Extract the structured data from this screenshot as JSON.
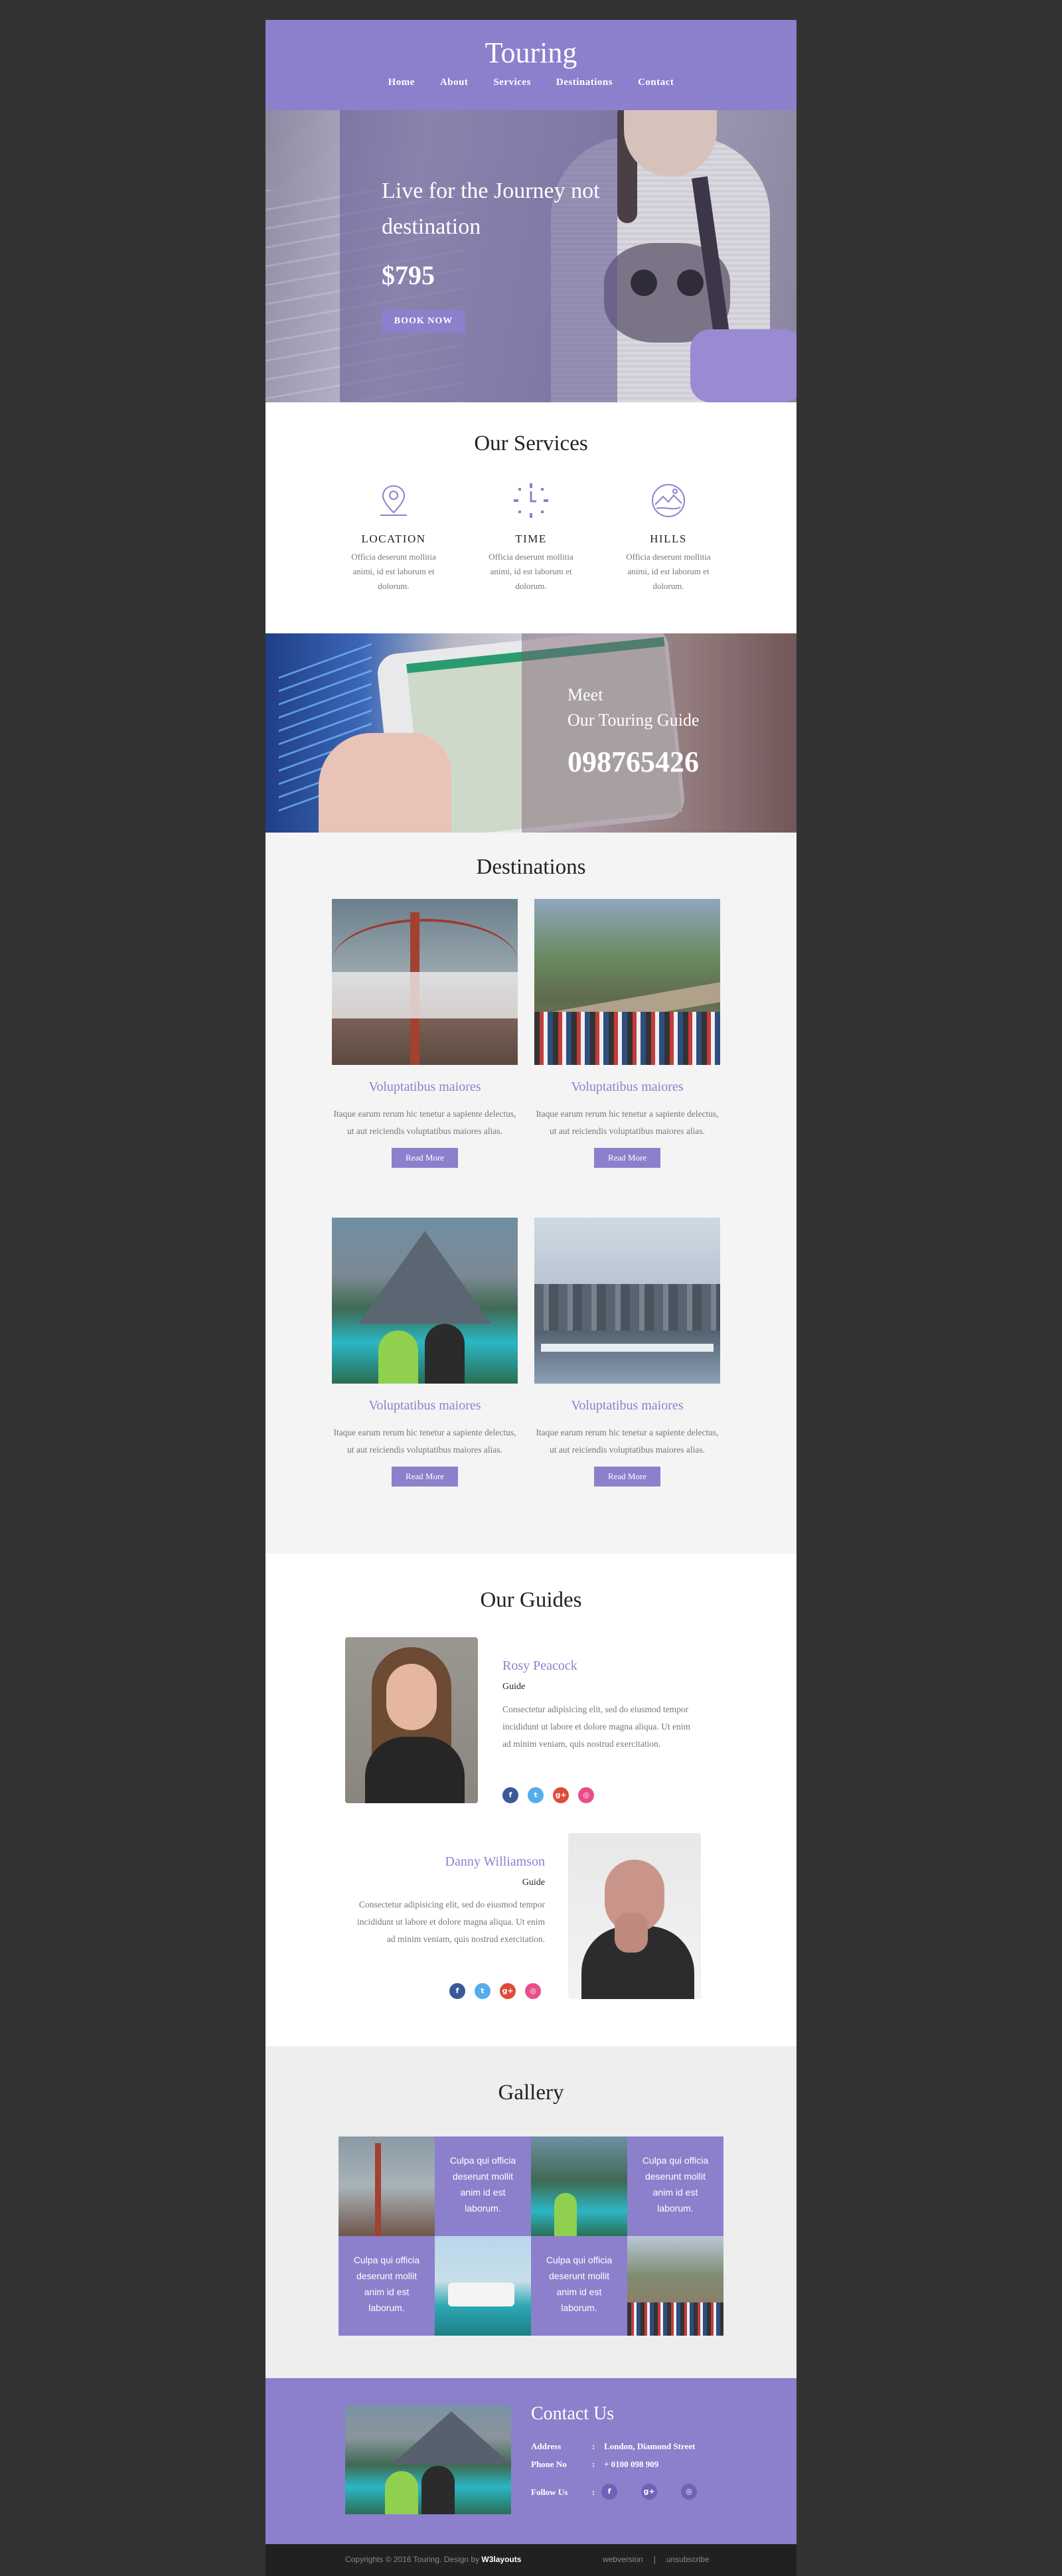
{
  "header": {
    "logo": "Touring",
    "nav": [
      "Home",
      "About",
      "Services",
      "Destinations",
      "Contact"
    ]
  },
  "hero": {
    "title": "Live for the Journey not destination",
    "price": "$795",
    "button": "BOOK NOW"
  },
  "services": {
    "title": "Our Services",
    "items": [
      {
        "icon": "map-pin-icon",
        "title": "LOCATION",
        "text": "Officia deserunt mollitia animi, id est laborum et dolorum."
      },
      {
        "icon": "clock-icon",
        "title": "TIME",
        "text": "Officia deserunt mollitia animi, id est laborum et dolorum."
      },
      {
        "icon": "hills-icon",
        "title": "HILLS",
        "text": "Officia deserunt mollitia animi, id est laborum et dolorum."
      }
    ]
  },
  "guide_banner": {
    "title_line1": "Meet",
    "title_line2": "Our Touring Guide",
    "phone": "098765426"
  },
  "destinations": {
    "title": "Destinations",
    "cards": [
      {
        "title": "Voluptatibus maiores",
        "text": "Itaque earum rerum hic tenetur a sapiente delectus, ut aut reiciendis voluptatibus maiores alias.",
        "button": "Read More"
      },
      {
        "title": "Voluptatibus maiores",
        "text": "Itaque earum rerum hic tenetur a sapiente delectus, ut aut reiciendis voluptatibus maiores alias.",
        "button": "Read More"
      },
      {
        "title": "Voluptatibus maiores",
        "text": "Itaque earum rerum hic tenetur a sapiente delectus, ut aut reiciendis voluptatibus maiores alias.",
        "button": "Read More"
      },
      {
        "title": "Voluptatibus maiores",
        "text": "Itaque earum rerum hic tenetur a sapiente delectus, ut aut reiciendis voluptatibus maiores alias.",
        "button": "Read More"
      }
    ]
  },
  "guides": {
    "title": "Our Guides",
    "people": [
      {
        "name": "Rosy Peacock",
        "role": "Guide",
        "text": "Consectetur adipisicing elit, sed do eiusmod tempor incididunt ut labore et dolore magna aliqua. Ut enim ad minim veniam, quis nostrud exercitation."
      },
      {
        "name": "Danny Williamson",
        "role": "Guide",
        "text": "Consectetur adipisicing elit, sed do eiusmod tempor incididunt ut labore et dolore magna aliqua. Ut enim ad minim veniam, quis nostrud exercitation."
      }
    ],
    "social_glyphs": {
      "facebook": "f",
      "twitter": "t",
      "googleplus": "g+",
      "instagram": "◎"
    }
  },
  "gallery": {
    "title": "Gallery",
    "caption": "Culpa qui officia deserunt mollit anim id est laborum."
  },
  "contact": {
    "title": "Contact Us",
    "address_label": "Address",
    "address": "London, Diamond Street",
    "phone_label": "Phone No",
    "phone": "+ 0100 098 909",
    "follow_label": "Follow Us",
    "separator": ":"
  },
  "footer": {
    "copyright": "Copyrights © 2016 Touring. Design by",
    "designer": "W3layouts",
    "webversion": "webversion",
    "divider": "|",
    "unsubscribe": "unsubscribe"
  },
  "colors": {
    "accent": "#8c80cc",
    "page_bg": "#333333",
    "footer_bg": "#212121",
    "facebook": "#3b5998",
    "twitter": "#55acee",
    "googleplus": "#dd4b39",
    "instagram": "#e94e8a"
  }
}
